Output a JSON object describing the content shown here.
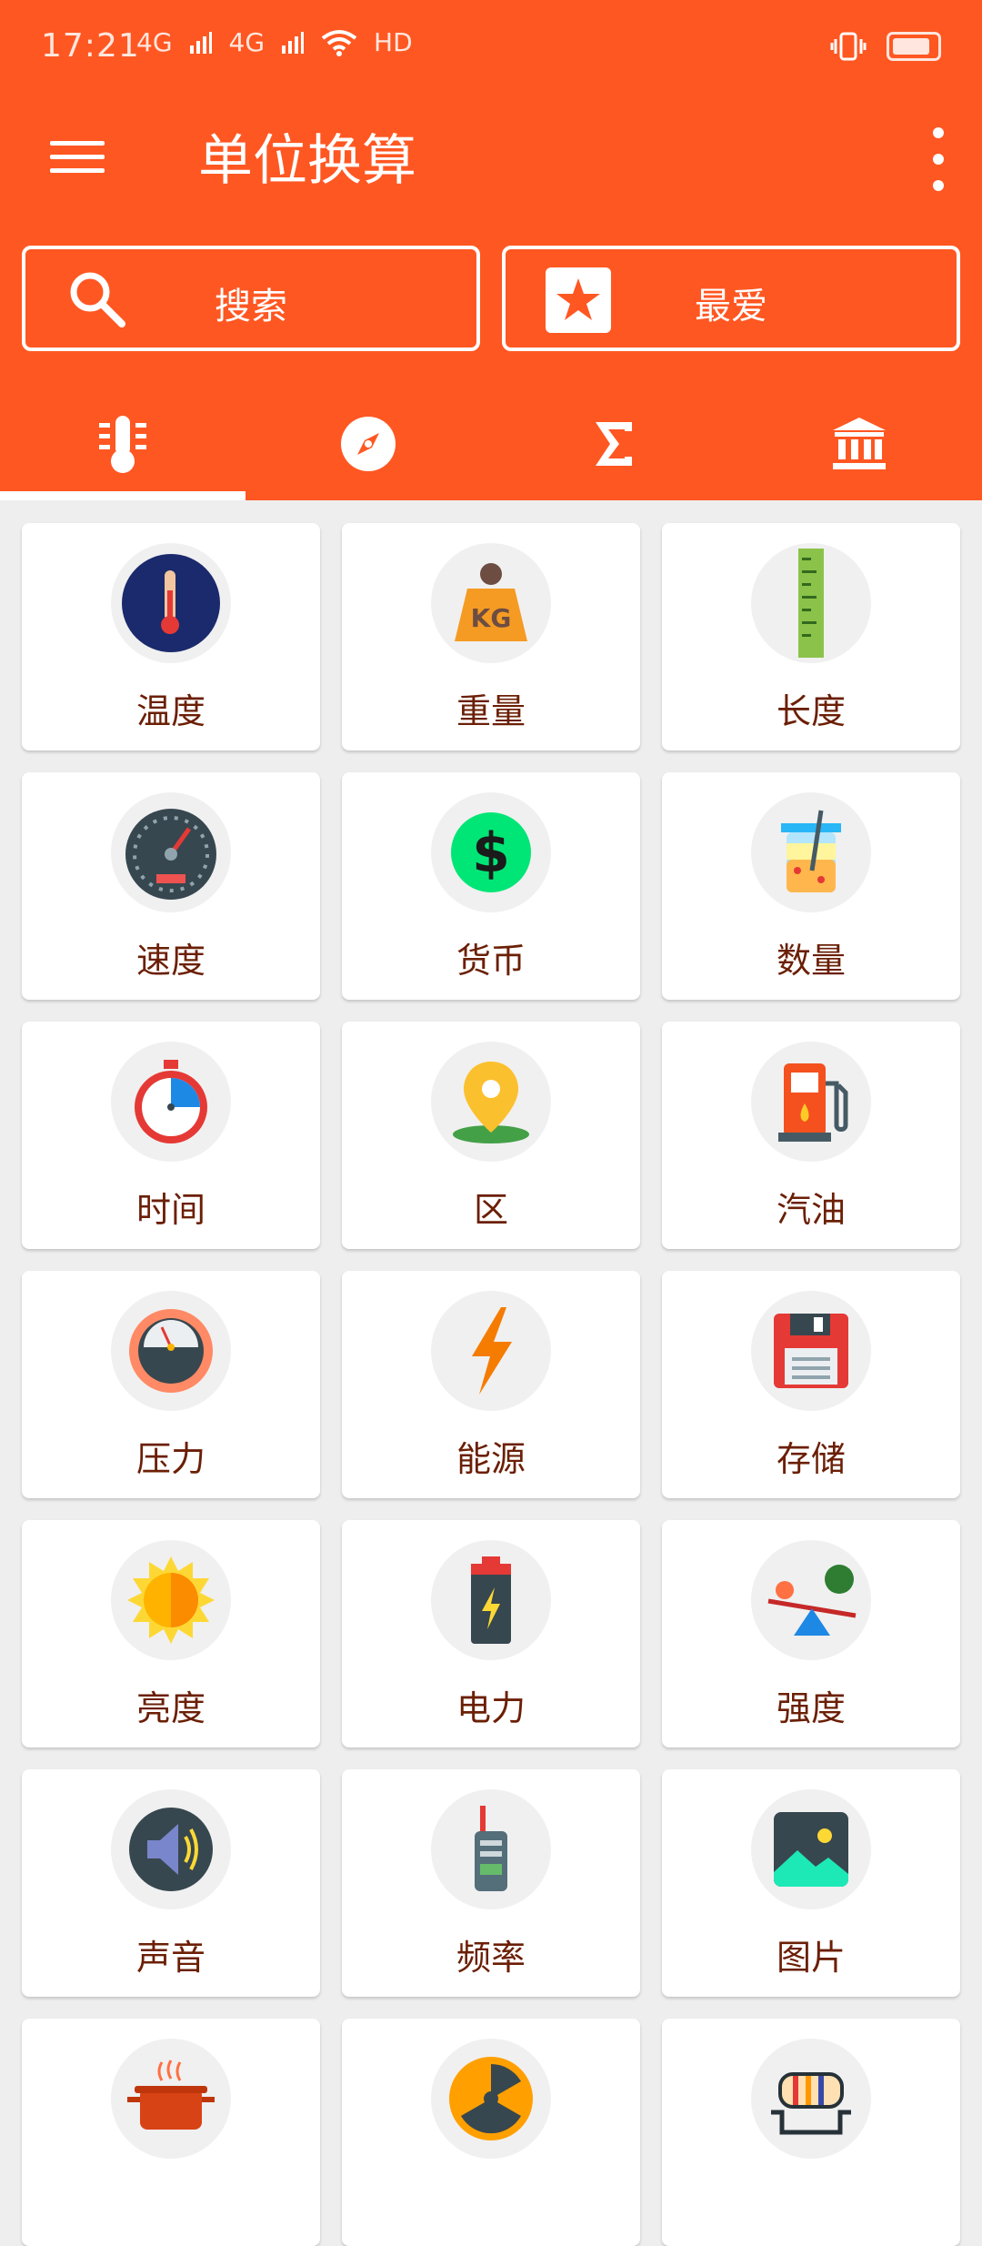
{
  "status": {
    "time": "17:21",
    "net1": "4G",
    "net2": "4G",
    "hd": "HD"
  },
  "appbar": {
    "title": "单位换算"
  },
  "actions": {
    "search_label": "搜索",
    "favorite_label": "最爱"
  },
  "tabs": [
    {
      "icon": "thermometer-list-icon"
    },
    {
      "icon": "compass-icon"
    },
    {
      "icon": "sigma-icon"
    },
    {
      "icon": "bank-icon"
    }
  ],
  "categories": [
    {
      "label": "温度",
      "icon": "thermometer-icon"
    },
    {
      "label": "重量",
      "icon": "weight-icon"
    },
    {
      "label": "长度",
      "icon": "ruler-icon"
    },
    {
      "label": "速度",
      "icon": "speedometer-icon"
    },
    {
      "label": "货币",
      "icon": "dollar-icon"
    },
    {
      "label": "数量",
      "icon": "beaker-icon"
    },
    {
      "label": "时间",
      "icon": "stopwatch-icon"
    },
    {
      "label": "区",
      "icon": "map-pin-icon"
    },
    {
      "label": "汽油",
      "icon": "fuel-pump-icon"
    },
    {
      "label": "压力",
      "icon": "pressure-gauge-icon"
    },
    {
      "label": "能源",
      "icon": "lightning-icon"
    },
    {
      "label": "存储",
      "icon": "floppy-disk-icon"
    },
    {
      "label": "亮度",
      "icon": "sun-icon"
    },
    {
      "label": "电力",
      "icon": "battery-icon"
    },
    {
      "label": "强度",
      "icon": "seesaw-icon"
    },
    {
      "label": "声音",
      "icon": "speaker-icon"
    },
    {
      "label": "频率",
      "icon": "walkie-talkie-icon"
    },
    {
      "label": "图片",
      "icon": "image-icon"
    },
    {
      "label": "",
      "icon": "cooking-pot-icon"
    },
    {
      "label": "",
      "icon": "radiation-icon"
    },
    {
      "label": "",
      "icon": "resistor-icon"
    }
  ],
  "colors": {
    "primary": "#ff5722",
    "background": "#eeeeee",
    "label": "#6b1f05"
  }
}
